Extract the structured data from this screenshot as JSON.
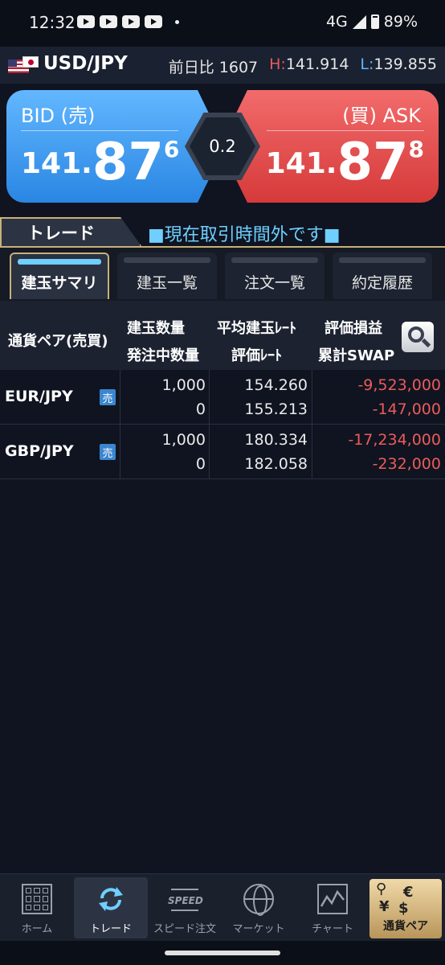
{
  "status_bar": {
    "time": "12:32",
    "network": "4G",
    "battery": "89%"
  },
  "header": {
    "pair": "USD/JPY",
    "change_label": "前日比",
    "change_value": "1607",
    "high_label": "H:",
    "high_value": "141.914",
    "low_label": "L:",
    "low_value": "139.855"
  },
  "quote": {
    "bid_label": "BID (売)",
    "bid": {
      "int": "141.",
      "main": "87",
      "small": "6"
    },
    "spread": "0.2",
    "ask_label": "(買) ASK",
    "ask": {
      "int": "141.",
      "main": "87",
      "small": "8"
    }
  },
  "trade": {
    "tab_label": "トレード",
    "market_status": "■現在取引時間外です■"
  },
  "tabs": [
    {
      "label": "建玉サマリ"
    },
    {
      "label": "建玉一覧"
    },
    {
      "label": "注文一覧"
    },
    {
      "label": "約定履歴"
    }
  ],
  "table": {
    "headers": {
      "pair": "通貨ペア(売買)",
      "qty": "建玉数量",
      "pending_qty": "発注中数量",
      "avg_rate": "平均建玉ﾚｰﾄ",
      "eval_rate": "評価ﾚｰﾄ",
      "pnl": "評価損益",
      "swap": "累計SWAP"
    },
    "rows": [
      {
        "pair": "EUR/JPY",
        "side": "売",
        "qty": "1,000",
        "pending_qty": "0",
        "avg_rate": "154.260",
        "eval_rate": "155.213",
        "pnl": "-9,523,000",
        "swap": "-147,000"
      },
      {
        "pair": "GBP/JPY",
        "side": "売",
        "qty": "1,000",
        "pending_qty": "0",
        "avg_rate": "180.334",
        "eval_rate": "182.058",
        "pnl": "-17,234,000",
        "swap": "-232,000"
      }
    ]
  },
  "nav": [
    {
      "label": "ホーム",
      "icon": "grid-icon"
    },
    {
      "label": "トレード",
      "icon": "refresh-icon"
    },
    {
      "label": "スピード注文",
      "icon": "speed-icon",
      "icon_text": "SPEED"
    },
    {
      "label": "マーケット",
      "icon": "globe-icon"
    },
    {
      "label": "チャート",
      "icon": "chart-icon"
    },
    {
      "label": "通貨ペア",
      "icon": "currency-icon"
    }
  ],
  "colors": {
    "bid": "#2a86e3",
    "ask": "#d63a3a",
    "accent": "#6fd0ff",
    "gold": "#c7b17a",
    "negative": "#ec5b5b"
  }
}
